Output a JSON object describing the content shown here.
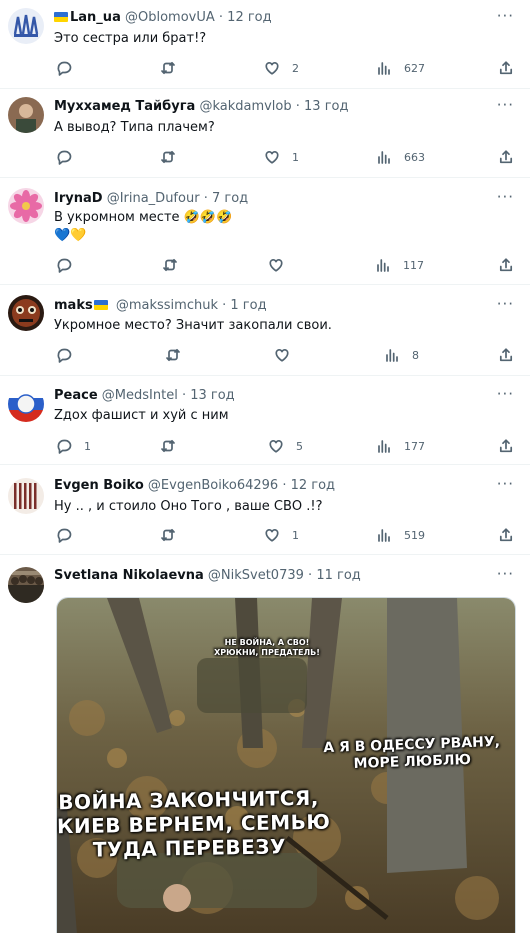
{
  "tweets": [
    {
      "name": "Lan_ua",
      "handle": "@OblomovUA",
      "time": "12 год",
      "lines": [
        "Это сестра или брат!?"
      ],
      "replies": "",
      "retweets": "",
      "likes": "2",
      "views": "627"
    },
    {
      "name": "Муххамед Тайбуга",
      "handle": "@kakdamvlob",
      "time": "13 год",
      "lines": [
        "А вывод? Типа плачем?"
      ],
      "replies": "",
      "retweets": "",
      "likes": "1",
      "views": "663"
    },
    {
      "name": "IrynaD",
      "handle": "@Irina_Dufour",
      "time": "7 год",
      "lines": [
        "В укромном месте 🤣🤣🤣",
        "💙💛"
      ],
      "replies": "",
      "retweets": "",
      "likes": "",
      "views": "117"
    },
    {
      "name": "maks",
      "handle": "@makssimchuk",
      "time": "1 год",
      "lines": [
        "Укромное место? Значит закопали свои."
      ],
      "replies": "",
      "retweets": "",
      "likes": "",
      "views": "8"
    },
    {
      "name": "Peace",
      "handle": "@MedsIntel",
      "time": "13 год",
      "lines": [
        "Zдох фашист и хуй с ним"
      ],
      "replies": "1",
      "retweets": "",
      "likes": "5",
      "views": "177"
    },
    {
      "name": "Evgen Boiko",
      "handle": "@EvgenBoiko64296",
      "time": "12 год",
      "lines": [
        "Ну .. , и стоило Оно Того , ваше СВО .!?"
      ],
      "replies": "",
      "retweets": "",
      "likes": "1",
      "views": "519"
    },
    {
      "name": "Svetlana Nikolaevna",
      "handle": "@NikSvet0739",
      "time": "11 год",
      "lines": [],
      "media_captions": {
        "top": "НЕ ВОЙНА, А СВО!\nХРЮКНИ, ПРЕДАТЕЛЬ!",
        "right": "А Я В ОДЕССУ РВАНУ,\nМОРЕ ЛЮБЛЮ",
        "left": "ВОЙНА ЗАКОНЧИТСЯ,\nКИЕВ ВЕРНЕМ, СЕМЬЮ\nТУДА ПЕРЕВЕЗУ"
      }
    }
  ],
  "more_label": "···",
  "colors": {
    "icon": "#536471",
    "text": "#0f1419",
    "divider": "#eff3f4",
    "flag_blue": "#2d6fd2",
    "flag_yellow": "#ffd500"
  }
}
